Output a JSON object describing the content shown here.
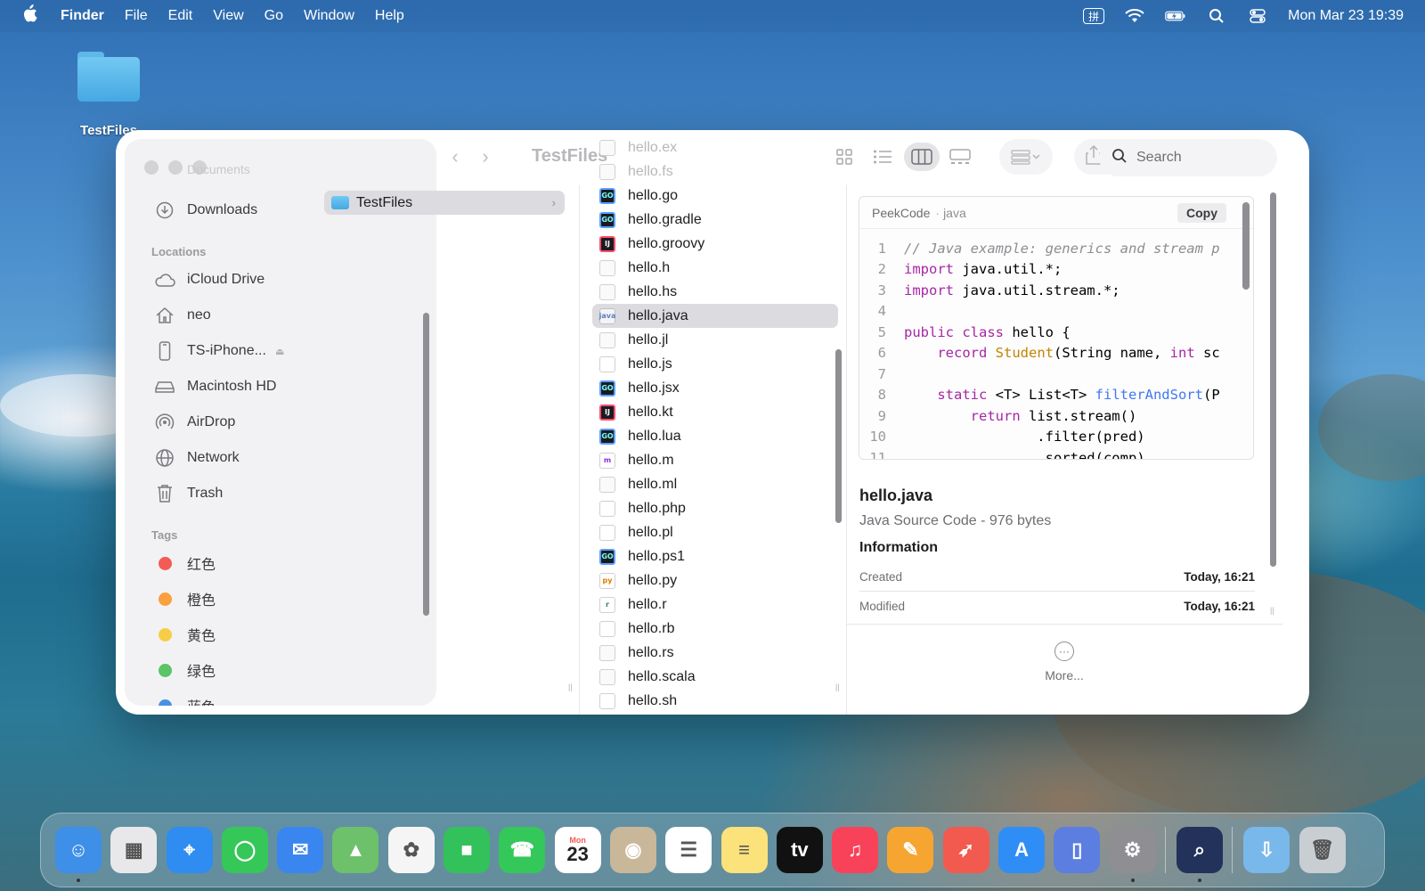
{
  "menubar": {
    "app_name": "Finder",
    "items": [
      "File",
      "Edit",
      "View",
      "Go",
      "Window",
      "Help"
    ],
    "input_method": "拼",
    "datetime": "Mon Mar 23  19:39"
  },
  "desktop": {
    "folder_label": "TestFiles"
  },
  "window": {
    "title": "TestFiles",
    "search_placeholder": "Search",
    "sidebar": {
      "faded_top": "Documents",
      "top_items": [
        {
          "label": "Downloads"
        }
      ],
      "locations_header": "Locations",
      "locations": [
        {
          "label": "iCloud Drive"
        },
        {
          "label": "neo"
        },
        {
          "label": "TS-iPhone..."
        },
        {
          "label": "Macintosh HD"
        },
        {
          "label": "AirDrop"
        },
        {
          "label": "Network"
        },
        {
          "label": "Trash"
        }
      ],
      "tags_header": "Tags",
      "tags": [
        {
          "label": "红色",
          "color": "#f25c54"
        },
        {
          "label": "橙色",
          "color": "#f9a03f"
        },
        {
          "label": "黄色",
          "color": "#f6cd46"
        },
        {
          "label": "绿色",
          "color": "#5ac467"
        },
        {
          "label": "蓝色",
          "color": "#4a90e2"
        }
      ]
    },
    "column1": {
      "items": [
        {
          "label": "TestFiles"
        }
      ]
    },
    "column2": {
      "items": [
        {
          "label": "hello.ex",
          "icon": "doc",
          "faded": true
        },
        {
          "label": "hello.fs",
          "icon": "doc",
          "faded": true
        },
        {
          "label": "hello.go",
          "icon": "go"
        },
        {
          "label": "hello.gradle",
          "icon": "go"
        },
        {
          "label": "hello.groovy",
          "icon": "jb"
        },
        {
          "label": "hello.h",
          "icon": "doc"
        },
        {
          "label": "hello.hs",
          "icon": "doc"
        },
        {
          "label": "hello.java",
          "icon": "java",
          "selected": true
        },
        {
          "label": "hello.jl",
          "icon": "doc"
        },
        {
          "label": "hello.js",
          "icon": "red"
        },
        {
          "label": "hello.jsx",
          "icon": "go"
        },
        {
          "label": "hello.kt",
          "icon": "jb"
        },
        {
          "label": "hello.lua",
          "icon": "go"
        },
        {
          "label": "hello.m",
          "icon": "purple"
        },
        {
          "label": "hello.ml",
          "icon": "doc"
        },
        {
          "label": "hello.php",
          "icon": "red"
        },
        {
          "label": "hello.pl",
          "icon": "red"
        },
        {
          "label": "hello.ps1",
          "icon": "go"
        },
        {
          "label": "hello.py",
          "icon": "orange"
        },
        {
          "label": "hello.r",
          "icon": "green"
        },
        {
          "label": "hello.rb",
          "icon": "red"
        },
        {
          "label": "hello.rs",
          "icon": "doc"
        },
        {
          "label": "hello.scala",
          "icon": "doc"
        },
        {
          "label": "hello.sh",
          "icon": "red"
        }
      ]
    },
    "preview": {
      "plugin": "PeekCode",
      "separator": "·",
      "language": "java",
      "copy_label": "Copy",
      "code_lines": [
        "// Java example: generics and stream p",
        "import java.util.*;",
        "import java.util.stream.*;",
        "",
        "public class hello {",
        "    record Student(String name, int sc",
        "",
        "    static <T> List<T> filterAndSort(P",
        "        return list.stream()",
        "                .filter(pred)",
        "                .sorted(comp)"
      ],
      "file_name": "hello.java",
      "file_kind": "Java Source Code - 976 bytes",
      "info_header": "Information",
      "meta": [
        {
          "key": "Created",
          "value": "Today, 16:21"
        },
        {
          "key": "Modified",
          "value": "Today, 16:21"
        }
      ],
      "more_label": "More..."
    }
  },
  "dock": {
    "apps": [
      {
        "name": "Finder",
        "color": "#3d8fe8",
        "glyph": "☺",
        "running": true
      },
      {
        "name": "Launchpad",
        "color": "#e8e8ea",
        "glyph": "▦"
      },
      {
        "name": "Safari",
        "color": "#2f8cf0",
        "glyph": "⌖"
      },
      {
        "name": "Messages",
        "color": "#36c759",
        "glyph": "◯"
      },
      {
        "name": "Mail",
        "color": "#3a86f0",
        "glyph": "✉"
      },
      {
        "name": "Maps",
        "color": "#6cc16a",
        "glyph": "▲"
      },
      {
        "name": "Photos",
        "color": "#f5f5f5",
        "glyph": "✿"
      },
      {
        "name": "FaceTime",
        "color": "#33c15b",
        "glyph": "■"
      },
      {
        "name": "Phone",
        "color": "#34c759",
        "glyph": "☎"
      },
      {
        "name": "Calendar",
        "color": "#ffffff",
        "glyph": "23"
      },
      {
        "name": "Contacts",
        "color": "#c9b79a",
        "glyph": "◉"
      },
      {
        "name": "Reminders",
        "color": "#ffffff",
        "glyph": "☰"
      },
      {
        "name": "Notes",
        "color": "#fbe27a",
        "glyph": "≡"
      },
      {
        "name": "TV",
        "color": "#111111",
        "glyph": "tv"
      },
      {
        "name": "Music",
        "color": "#f8425a",
        "glyph": "♫"
      },
      {
        "name": "Pages",
        "color": "#f7a531",
        "glyph": "✎"
      },
      {
        "name": "Rocket",
        "color": "#f25a50",
        "glyph": "➶"
      },
      {
        "name": "App Store",
        "color": "#2e8ef5",
        "glyph": "A"
      },
      {
        "name": "iPhone Mirroring",
        "color": "#5b7ee0",
        "glyph": "▯"
      },
      {
        "name": "System Settings",
        "color": "#8e8e93",
        "glyph": "⚙",
        "running": true
      },
      {
        "name": "PeekCode",
        "color": "#22325a",
        "glyph": "⌕",
        "running": true
      },
      {
        "name": "Downloads",
        "color": "#79b8ea",
        "glyph": "⇩"
      },
      {
        "name": "Trash",
        "color": "#c9ced3",
        "glyph": "🗑"
      }
    ],
    "calendar_month": "Mon"
  }
}
